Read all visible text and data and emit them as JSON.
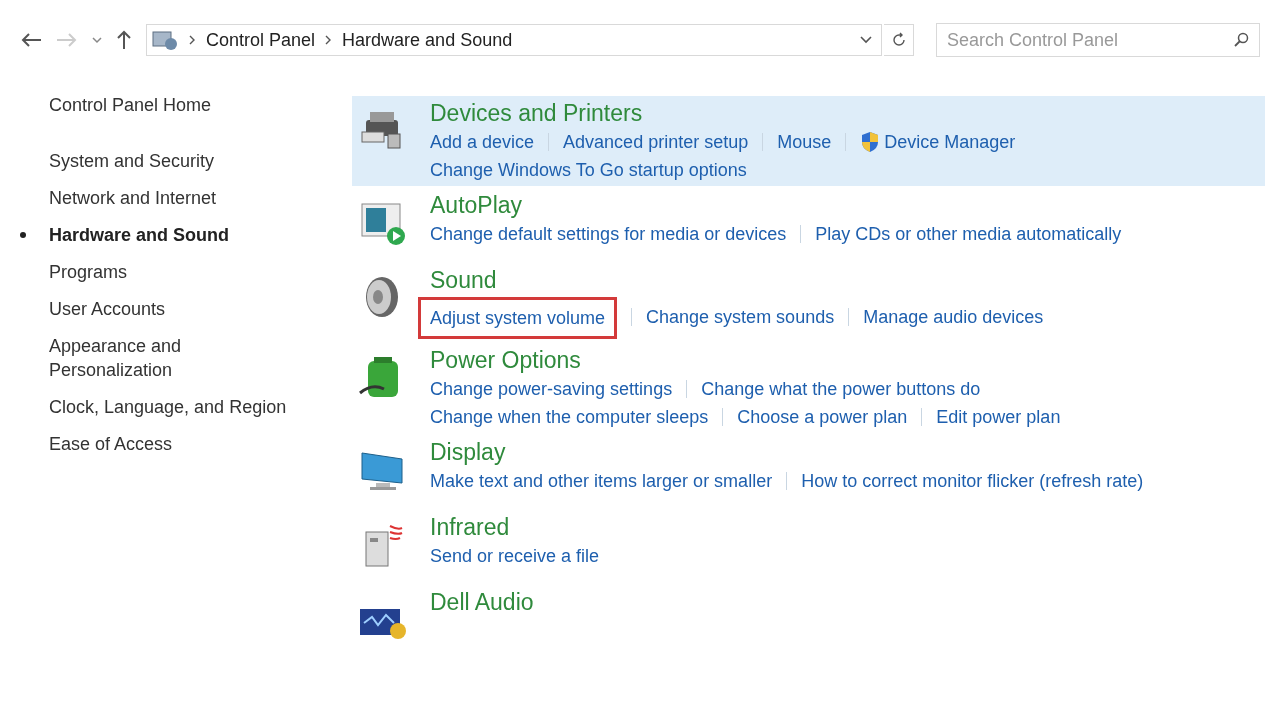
{
  "nav": {
    "back_disabled": false,
    "forward_disabled": true
  },
  "address": {
    "crumbs": [
      "Control Panel",
      "Hardware and Sound"
    ]
  },
  "search": {
    "placeholder": "Search Control Panel"
  },
  "sidebar": {
    "home": "Control Panel Home",
    "items": [
      {
        "label": "System and Security",
        "selected": false
      },
      {
        "label": "Network and Internet",
        "selected": false
      },
      {
        "label": "Hardware and Sound",
        "selected": true
      },
      {
        "label": "Programs",
        "selected": false
      },
      {
        "label": "User Accounts",
        "selected": false
      },
      {
        "label": "Appearance and Personalization",
        "selected": false
      },
      {
        "label": "Clock, Language, and Region",
        "selected": false
      },
      {
        "label": "Ease of Access",
        "selected": false
      }
    ]
  },
  "categories": [
    {
      "kind": "printer",
      "title": "Devices and Printers",
      "selected": true,
      "lines": [
        [
          {
            "label": "Add a device",
            "shield": false,
            "boxed": false
          },
          {
            "label": "Advanced printer setup",
            "shield": false,
            "boxed": false
          },
          {
            "label": "Mouse",
            "shield": false,
            "boxed": false
          },
          {
            "label": "Device Manager",
            "shield": true,
            "boxed": false
          }
        ],
        [
          {
            "label": "Change Windows To Go startup options",
            "shield": false,
            "boxed": false
          }
        ]
      ]
    },
    {
      "kind": "autoplay",
      "title": "AutoPlay",
      "selected": false,
      "lines": [
        [
          {
            "label": "Change default settings for media or devices",
            "shield": false,
            "boxed": false
          },
          {
            "label": "Play CDs or other media automatically",
            "shield": false,
            "boxed": false
          }
        ]
      ]
    },
    {
      "kind": "speaker",
      "title": "Sound",
      "selected": false,
      "lines": [
        [
          {
            "label": "Adjust system volume",
            "shield": false,
            "boxed": true
          },
          {
            "label": "Change system sounds",
            "shield": false,
            "boxed": false
          },
          {
            "label": "Manage audio devices",
            "shield": false,
            "boxed": false
          }
        ]
      ]
    },
    {
      "kind": "battery",
      "title": "Power Options",
      "selected": false,
      "lines": [
        [
          {
            "label": "Change power-saving settings",
            "shield": false,
            "boxed": false
          },
          {
            "label": "Change what the power buttons do",
            "shield": false,
            "boxed": false
          }
        ],
        [
          {
            "label": "Change when the computer sleeps",
            "shield": false,
            "boxed": false
          },
          {
            "label": "Choose a power plan",
            "shield": false,
            "boxed": false
          },
          {
            "label": "Edit power plan",
            "shield": false,
            "boxed": false
          }
        ]
      ]
    },
    {
      "kind": "monitor",
      "title": "Display",
      "selected": false,
      "lines": [
        [
          {
            "label": "Make text and other items larger or smaller",
            "shield": false,
            "boxed": false
          },
          {
            "label": "How to correct monitor flicker (refresh rate)",
            "shield": false,
            "boxed": false
          }
        ]
      ]
    },
    {
      "kind": "infrared",
      "title": "Infrared",
      "selected": false,
      "lines": [
        [
          {
            "label": "Send or receive a file",
            "shield": false,
            "boxed": false
          }
        ]
      ]
    },
    {
      "kind": "audio",
      "title": "Dell Audio",
      "selected": false
    }
  ]
}
